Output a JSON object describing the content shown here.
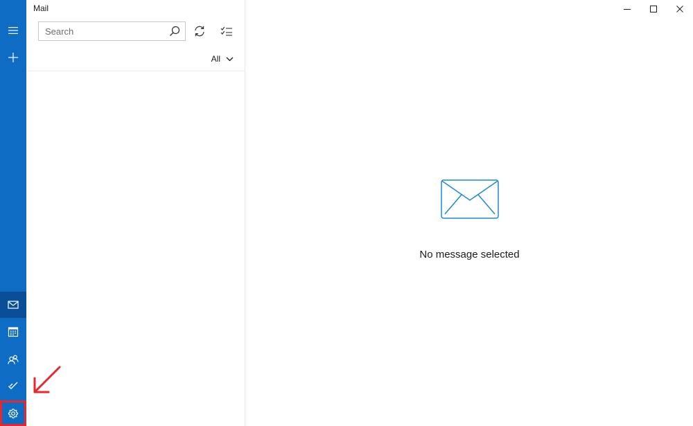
{
  "app": {
    "title": "Mail"
  },
  "search": {
    "placeholder": "Search",
    "value": ""
  },
  "filter": {
    "label": "All"
  },
  "reading_pane": {
    "empty_message": "No message selected"
  },
  "rail": {
    "top_items": [
      {
        "name": "menu",
        "icon": "hamburger-icon"
      },
      {
        "name": "new-mail",
        "icon": "plus-icon"
      }
    ],
    "bottom_items": [
      {
        "name": "mail",
        "icon": "mail-icon",
        "active": true
      },
      {
        "name": "calendar",
        "icon": "calendar-icon"
      },
      {
        "name": "people",
        "icon": "people-icon"
      },
      {
        "name": "todo",
        "icon": "checkmark-icon"
      },
      {
        "name": "settings",
        "icon": "gear-icon",
        "highlighted": true
      }
    ]
  },
  "colors": {
    "rail_bg": "#0f6cc4",
    "rail_active": "#0a4e96",
    "accent": "#1e88d6",
    "annotation": "#e8262b"
  }
}
